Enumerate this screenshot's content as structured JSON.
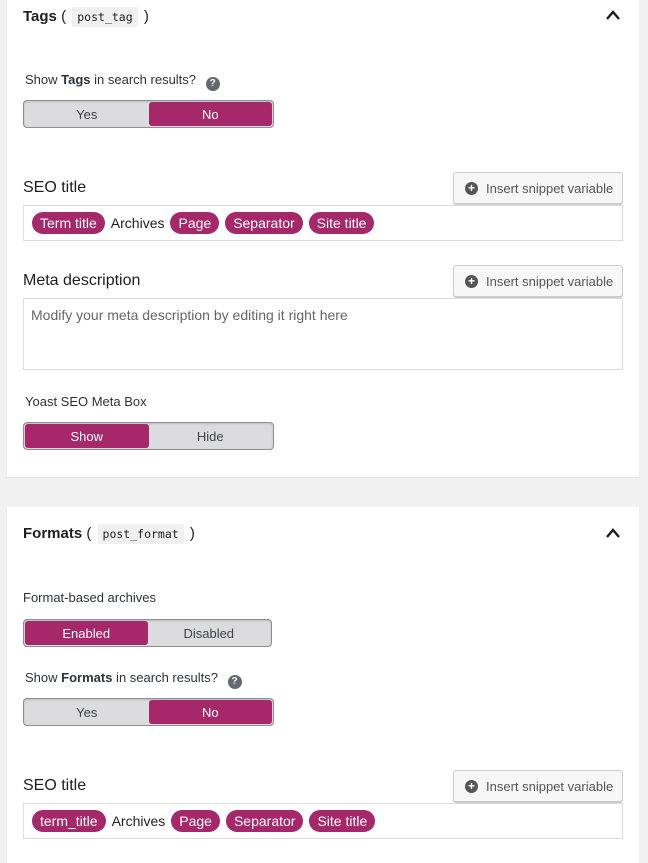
{
  "colors": {
    "accent": "#a4286a",
    "panel_bg": "#ffffff",
    "page_bg": "#f1f1f1"
  },
  "tags_panel": {
    "title": "Tags",
    "taxonomy": "post_tag",
    "paren_open": "(",
    "paren_close": ")",
    "collapse_icon": "chevron-up-icon",
    "search_question_prefix": "Show ",
    "search_question_bold": "Tags",
    "search_question_suffix": " in search results?",
    "search_toggle": {
      "yes": "Yes",
      "no": "No",
      "selected": "No"
    },
    "seo_title_label": "SEO title",
    "insert_snippet_label": "Insert snippet variable",
    "seo_title_tokens": {
      "t1": "Term title",
      "t2": "Archives",
      "t3": "Page",
      "t4": "Separator",
      "t5": "Site title"
    },
    "meta_description_label": "Meta description",
    "meta_description_placeholder": "Modify your meta description by editing it right here",
    "metabox_label": "Yoast SEO Meta Box",
    "metabox_toggle": {
      "show": "Show",
      "hide": "Hide",
      "selected": "Show"
    }
  },
  "formats_panel": {
    "title": "Formats",
    "taxonomy": "post_format",
    "paren_open": "(",
    "paren_close": ")",
    "collapse_icon": "chevron-up-icon",
    "archives_label": "Format-based archives",
    "archives_toggle": {
      "enabled": "Enabled",
      "disabled": "Disabled",
      "selected": "Enabled"
    },
    "search_question_prefix": "Show ",
    "search_question_bold": "Formats",
    "search_question_suffix": " in search results?",
    "search_toggle": {
      "yes": "Yes",
      "no": "No",
      "selected": "No"
    },
    "seo_title_label": "SEO title",
    "insert_snippet_label": "Insert snippet variable",
    "seo_title_tokens": {
      "t1": "term_title",
      "t2": "Archives",
      "t3": "Page",
      "t4": "Separator",
      "t5": "Site title"
    }
  }
}
